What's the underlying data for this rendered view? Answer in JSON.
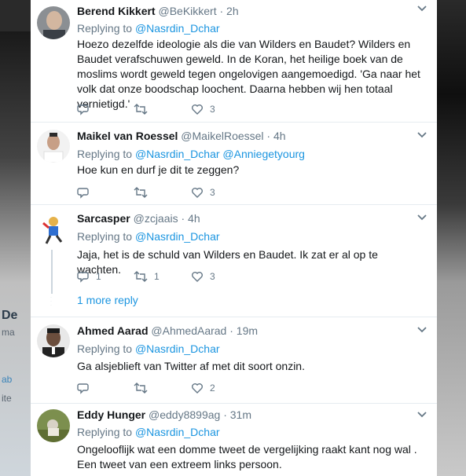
{
  "background": {
    "left_fragments": [
      "De",
      "ma",
      "ab",
      "ite"
    ]
  },
  "tweets": [
    {
      "name": "Berend Kikkert",
      "handle": "@BeKikkert · 2h",
      "replying_label": "Replying to",
      "replying_to": [
        "@Nasrdin_Dchar"
      ],
      "text": "Hoezo dezelfde ideologie als die van Wilders en Baudet? Wilders en Baudet verafschuwen geweld. In de Koran, het heilige boek van de moslims wordt geweld tegen ongelovigen aangemoedigd. 'Ga naar het volk dat onze boodschap loochent. Daarna hebben wij hen totaal vernietigd.'",
      "replies": "",
      "retweets": "",
      "likes": "3"
    },
    {
      "name": "Maikel van Roessel",
      "handle": "@MaikelRoessel · 4h",
      "replying_label": "Replying to",
      "replying_to": [
        "@Nasrdin_Dchar",
        "@Anniegetyourg"
      ],
      "text": "Hoe kun en durf je dit te zeggen?",
      "replies": "",
      "retweets": "",
      "likes": "3"
    },
    {
      "name": "Sarcasper",
      "handle": "@zcjaais · 4h",
      "replying_label": "Replying to",
      "replying_to": [
        "@Nasrdin_Dchar"
      ],
      "text": "Jaja, het is de schuld van Wilders en Baudet. Ik zat er al op te wachten.",
      "replies": "1",
      "retweets": "1",
      "likes": "3",
      "more_replies": "1 more reply"
    },
    {
      "name": "Ahmed Aarad",
      "handle": "@AhmedAarad · 19m",
      "replying_label": "Replying to",
      "replying_to": [
        "@Nasrdin_Dchar"
      ],
      "text": "Ga alsjeblieft van Twitter af met dit soort onzin.",
      "replies": "",
      "retweets": "",
      "likes": "2"
    },
    {
      "name": "Eddy Hunger",
      "handle": "@eddy8899ag · 31m",
      "replying_label": "Replying to",
      "replying_to": [
        "@Nasrdin_Dchar"
      ],
      "text": "Ongelooflijk wat een domme tweet de vergelijking raakt kant nog wal . Een tweet van een extreem links persoon.",
      "replies": "",
      "retweets": "",
      "likes": ""
    }
  ],
  "icons": {
    "reply": "reply-icon",
    "retweet": "retweet-icon",
    "like": "heart-icon",
    "menu": "chevron-down-icon"
  },
  "colors": {
    "link": "#1b95e0",
    "muted": "#657786",
    "text": "#14171a"
  }
}
